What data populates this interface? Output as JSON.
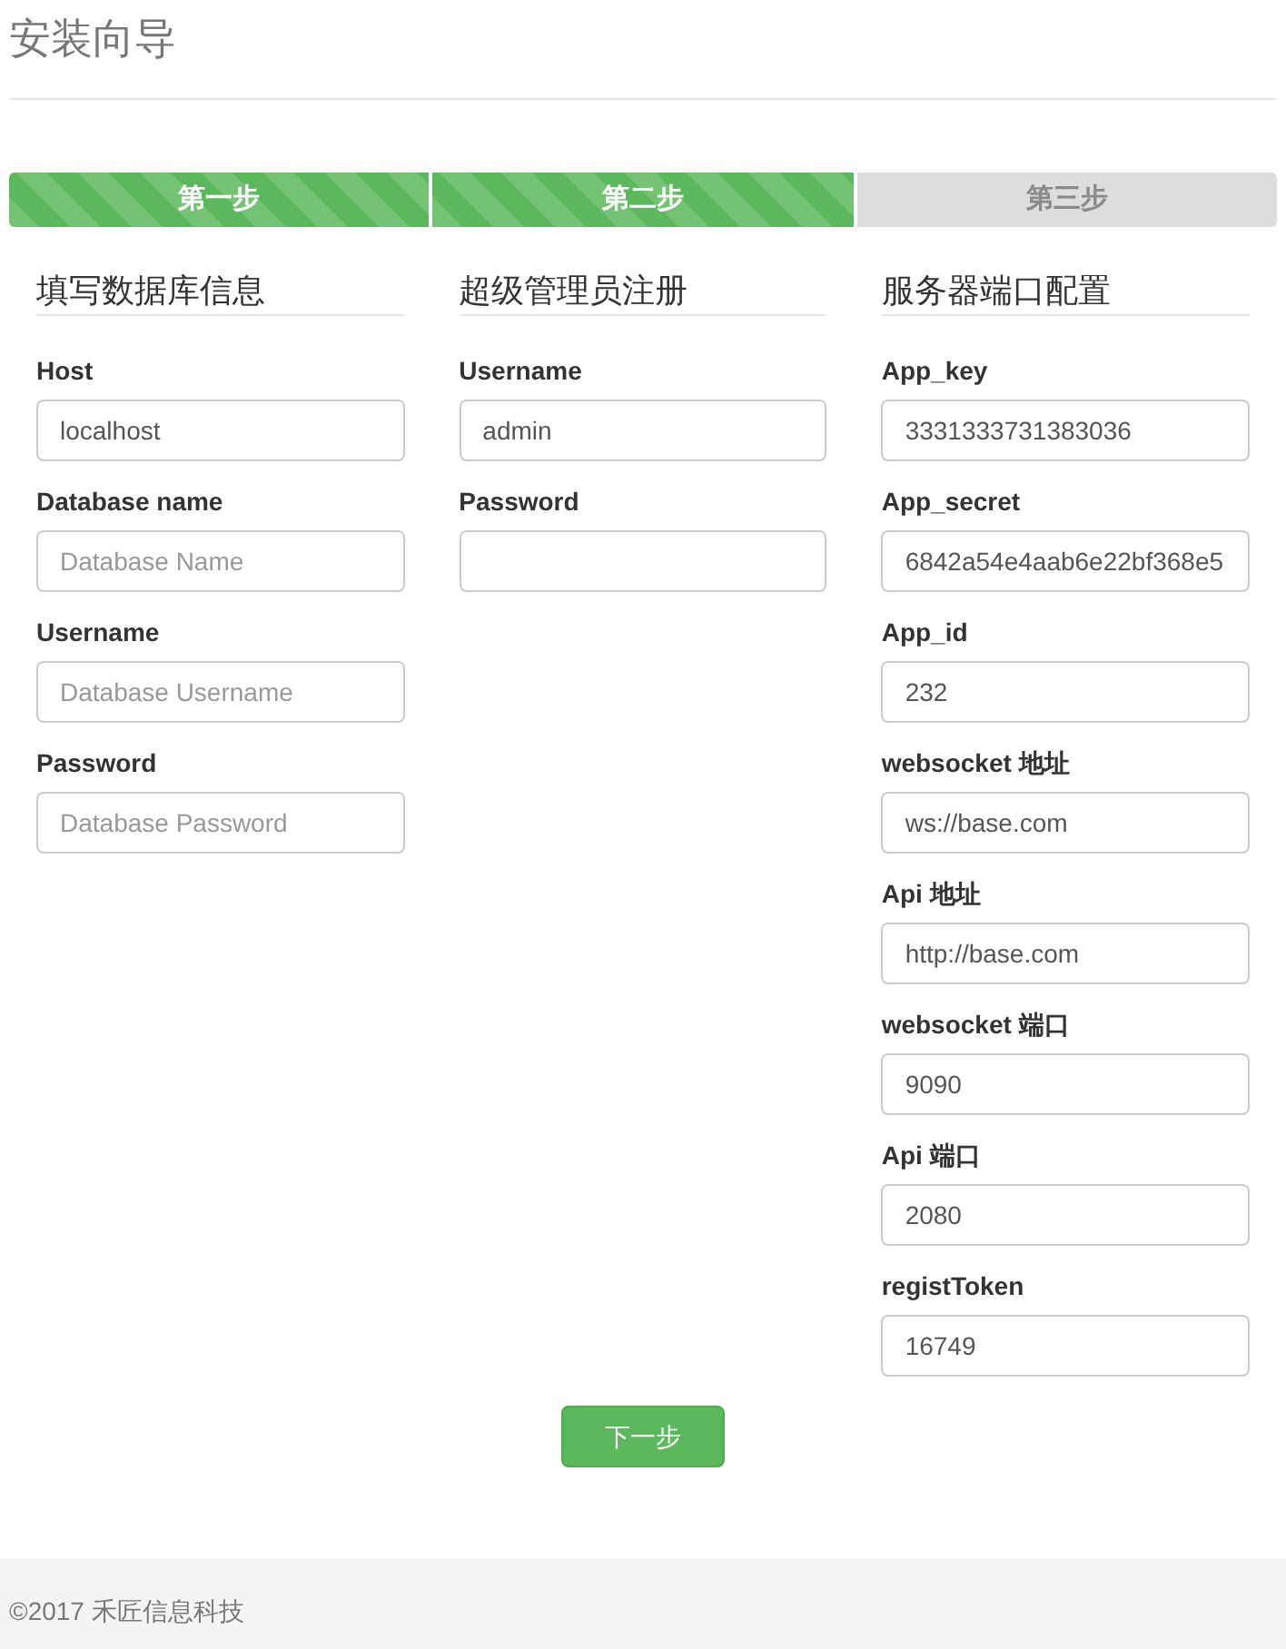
{
  "page": {
    "title": "安装向导"
  },
  "steps": [
    {
      "label": "第一步",
      "done": true
    },
    {
      "label": "第二步",
      "done": true
    },
    {
      "label": "第三步",
      "done": false
    }
  ],
  "sections": [
    {
      "heading": "填写数据库信息",
      "fields": [
        {
          "label": "Host",
          "value": "localhost"
        },
        {
          "label": "Database name",
          "placeholder": "Database Name"
        },
        {
          "label": "Username",
          "placeholder": "Database Username"
        },
        {
          "label": "Password",
          "placeholder": "Database Password"
        }
      ]
    },
    {
      "heading": "超级管理员注册",
      "fields": [
        {
          "label": "Username",
          "value": "admin"
        },
        {
          "label": "Password"
        }
      ]
    },
    {
      "heading": "服务器端口配置",
      "fields": [
        {
          "label": "App_key",
          "value": "3331333731383036"
        },
        {
          "label": "App_secret",
          "value": "6842a54e4aab6e22bf368e5"
        },
        {
          "label": "App_id",
          "value": "232"
        },
        {
          "label": "websocket 地址",
          "value": "ws://base.com"
        },
        {
          "label": "Api 地址",
          "value": "http://base.com"
        },
        {
          "label": "websocket 端口",
          "value": "9090"
        },
        {
          "label": "Api 端口",
          "value": "2080"
        },
        {
          "label": "registToken",
          "value": "16749"
        }
      ]
    }
  ],
  "next_button": "下一步",
  "footer": "©2017 禾匠信息科技"
}
